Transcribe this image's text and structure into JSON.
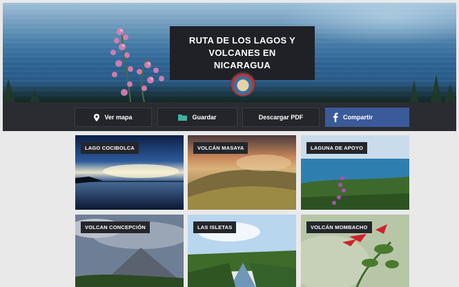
{
  "hero": {
    "title": "RUTA DE LOS LAGOS Y VOLCANES EN NICARAGUA"
  },
  "actions": [
    {
      "label": "Ver mapa",
      "icon": "map-pin-icon"
    },
    {
      "label": "Guardar",
      "icon": "folder-icon"
    },
    {
      "label": "Descargar PDF",
      "icon": ""
    },
    {
      "label": "Compartir",
      "icon": "facebook-icon"
    }
  ],
  "colors": {
    "bar": "#2a2c31",
    "share_button": "#3b5a9a",
    "guardar_icon": "#3fb3a0",
    "label_bg": "#24262b"
  },
  "cards": [
    {
      "title": "LAGO COCIBOLCA"
    },
    {
      "title": "VOLCÁN MASAYA"
    },
    {
      "title": "LAGUNA DE APOYO"
    },
    {
      "title": "VOLCAN CONCEPCIÓN"
    },
    {
      "title": "LAS ISLETAS"
    },
    {
      "title": "VOLCÁN MOMBACHO"
    }
  ]
}
